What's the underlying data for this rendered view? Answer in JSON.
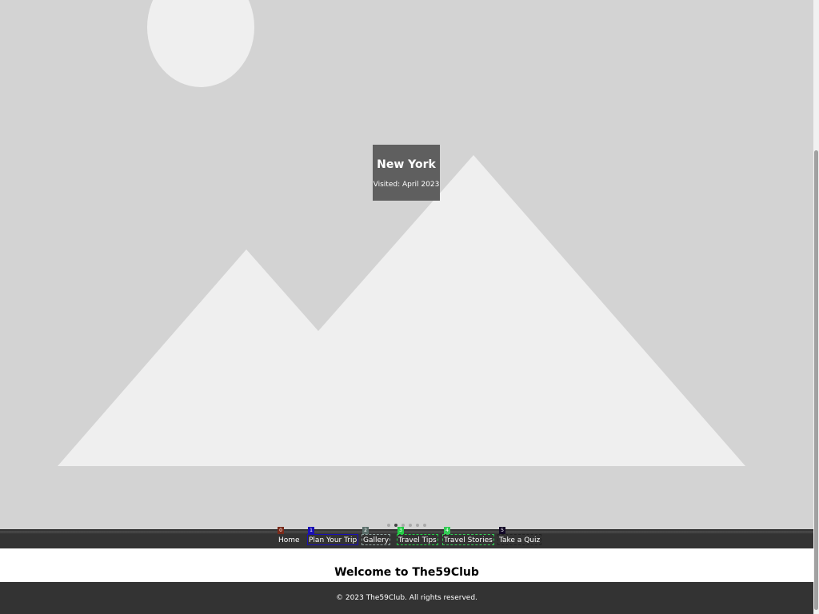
{
  "hero": {
    "image_icon": "image-placeholder-icon",
    "caption_title": "New York",
    "caption_subtitle": "Visited: April 2023",
    "slides_total": 6,
    "active_slide": 2
  },
  "nav": {
    "items": [
      {
        "label": "Home",
        "badge": "0",
        "badge_color": "#7a2a1a"
      },
      {
        "label": "Plan Your Trip",
        "badge": "1",
        "badge_color": "#1a0fb5"
      },
      {
        "label": "Gallery",
        "badge": "2",
        "badge_color": "#5a6e6a"
      },
      {
        "label": "Travel Tips",
        "badge": "3",
        "badge_color": "#22cc44"
      },
      {
        "label": "Travel Stories",
        "badge": "4",
        "badge_color": "#33cc55"
      },
      {
        "label": "Take a Quiz",
        "badge": "5",
        "badge_color": "#140a28"
      }
    ]
  },
  "main": {
    "title": "Welcome to The59Club"
  },
  "footer": {
    "text": "© 2023 The59Club. All rights reserved."
  }
}
